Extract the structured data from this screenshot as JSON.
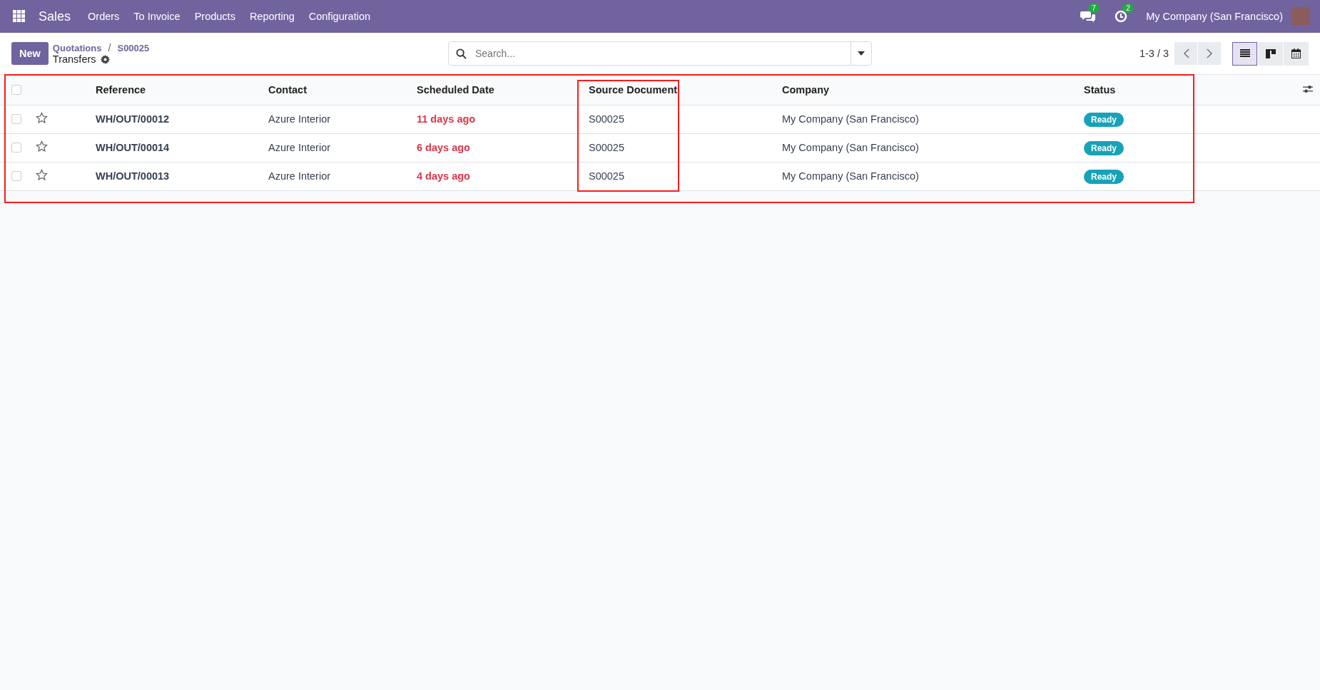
{
  "navbar": {
    "app": "Sales",
    "menu": [
      "Orders",
      "To Invoice",
      "Products",
      "Reporting",
      "Configuration"
    ],
    "messages_count": "7",
    "activities_count": "2",
    "company": "My Company (San Francisco)"
  },
  "control_panel": {
    "new_button": "New",
    "breadcrumbs": [
      "Quotations",
      "S00025"
    ],
    "breadcrumb_separator": "/",
    "title": "Transfers",
    "search": {
      "placeholder": "Search..."
    },
    "pager": "1-3 / 3",
    "views": [
      {
        "kind": "list",
        "selected": true
      },
      {
        "kind": "kanban",
        "selected": false
      },
      {
        "kind": "calendar",
        "selected": false
      }
    ]
  },
  "table": {
    "columns": [
      "Reference",
      "Contact",
      "Scheduled Date",
      "Source Document",
      "Company",
      "Status"
    ],
    "select_all": {
      "checked": false
    },
    "rows": [
      {
        "checked": false,
        "starred": false,
        "reference": "WH/OUT/00012",
        "contact": "Azure Interior",
        "scheduled_date": "11 days ago",
        "late": true,
        "source_document": "S00025",
        "company": "My Company (San Francisco)",
        "status": "Ready"
      },
      {
        "checked": false,
        "starred": false,
        "reference": "WH/OUT/00014",
        "contact": "Azure Interior",
        "scheduled_date": "6 days ago",
        "late": true,
        "source_document": "S00025",
        "company": "My Company (San Francisco)",
        "status": "Ready"
      },
      {
        "checked": false,
        "starred": false,
        "reference": "WH/OUT/00013",
        "contact": "Azure Interior",
        "scheduled_date": "4 days ago",
        "late": true,
        "source_document": "S00025",
        "company": "My Company (San Francisco)",
        "status": "Ready"
      }
    ]
  },
  "highlights": {
    "table": true,
    "source_document_column": true
  }
}
